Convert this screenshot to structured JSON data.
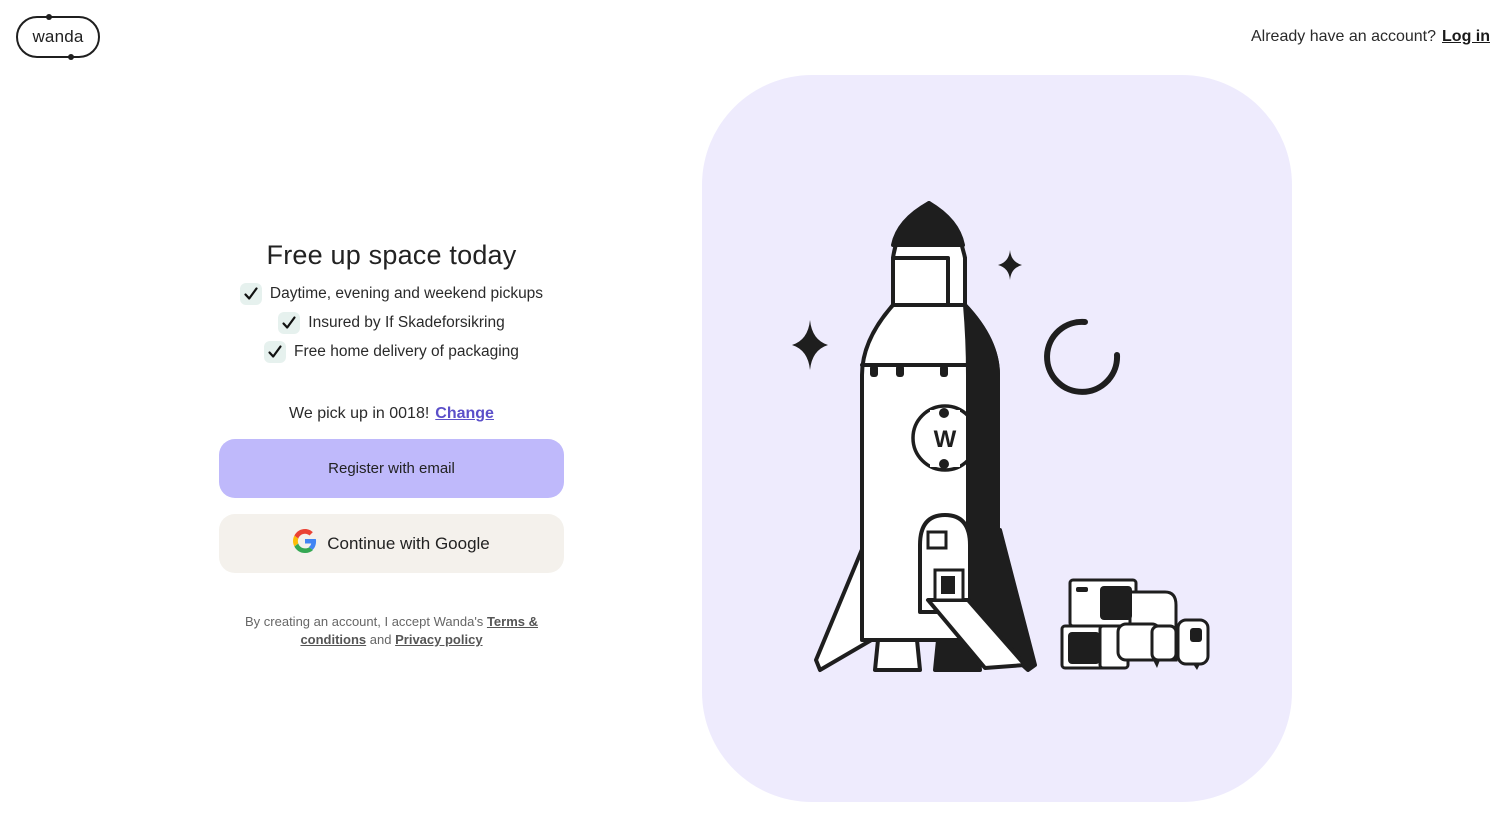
{
  "brand": {
    "name": "wanda"
  },
  "topbar": {
    "prompt": "Already have an account?",
    "login_label": "Log in"
  },
  "signup": {
    "title": "Free up space today",
    "benefits": [
      {
        "label": "Daytime, evening and weekend pickups"
      },
      {
        "label": "Insured by If Skadeforsikring"
      },
      {
        "label": "Free home delivery of packaging"
      }
    ],
    "pickup_text": "We pick up in 0018!",
    "change_label": "Change",
    "register_email_label": "Register with email",
    "google_label": "Continue with Google",
    "legal": {
      "prefix": "By creating an account, I accept Wanda's",
      "terms_label": "Terms & conditions",
      "conjunction": "and",
      "privacy_label": "Privacy policy"
    }
  },
  "hero": {
    "logo_letter": "W"
  },
  "colors": {
    "accent": "#bfb9fb",
    "link": "#5b4fc9",
    "hero_background": "#eeebfd",
    "google_button": "#f4f1ec",
    "check_background": "#e6f1ee"
  },
  "icons": [
    "wanda-logo",
    "check-icon",
    "google-icon",
    "rocket-illustration",
    "star-icon",
    "moon-icon",
    "furniture-illustration"
  ]
}
